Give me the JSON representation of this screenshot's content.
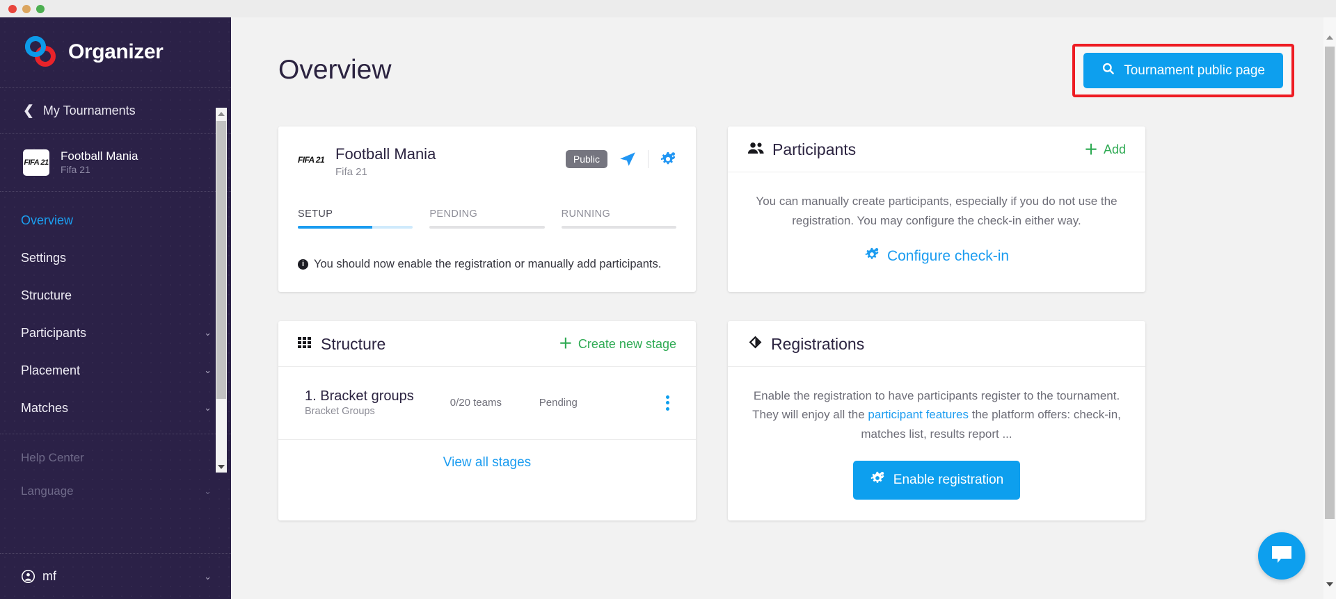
{
  "window": {
    "traffic_lights": [
      "close",
      "minimize",
      "maximize"
    ]
  },
  "sidebar": {
    "brand": "Organizer",
    "back_link": "My Tournaments",
    "tournament": {
      "thumb_label": "FIFA 21",
      "name": "Football Mania",
      "game": "Fifa 21"
    },
    "nav": [
      {
        "label": "Overview",
        "active": true,
        "expandable": false
      },
      {
        "label": "Settings",
        "active": false,
        "expandable": false
      },
      {
        "label": "Structure",
        "active": false,
        "expandable": false
      },
      {
        "label": "Participants",
        "active": false,
        "expandable": true
      },
      {
        "label": "Placement",
        "active": false,
        "expandable": true
      },
      {
        "label": "Matches",
        "active": false,
        "expandable": true
      }
    ],
    "secondary": [
      {
        "label": "Help Center",
        "expandable": false
      },
      {
        "label": "Language",
        "expandable": true
      }
    ],
    "user": {
      "label": "mf"
    }
  },
  "header": {
    "title": "Overview",
    "public_page_button": "Tournament public page"
  },
  "tournament_card": {
    "thumb_label": "FIFA 21",
    "name": "Football Mania",
    "game": "Fifa 21",
    "visibility_badge": "Public",
    "steps": [
      {
        "label": "SETUP",
        "active": true,
        "progress": 65
      },
      {
        "label": "PENDING",
        "active": false,
        "progress": 0
      },
      {
        "label": "RUNNING",
        "active": false,
        "progress": 0
      }
    ],
    "note": "You should now enable the registration or manually add participants."
  },
  "participants_card": {
    "title": "Participants",
    "add_label": "Add",
    "description": "You can manually create participants, especially if you do not use the registration. You may configure the check-in either way.",
    "configure_link": "Configure check-in"
  },
  "structure_card": {
    "title": "Structure",
    "create_label": "Create new stage",
    "stages": [
      {
        "name": "1. Bracket groups",
        "type": "Bracket Groups",
        "teams": "0/20 teams",
        "status": "Pending"
      }
    ],
    "view_all": "View all stages"
  },
  "registrations_card": {
    "title": "Registrations",
    "description_part1": "Enable the registration to have participants register to the tournament. They will enjoy all the ",
    "description_link": "participant features",
    "description_part2": " the platform offers: check-in, matches list, results report ...",
    "enable_button": "Enable registration"
  },
  "colors": {
    "sidebar_bg": "#2b2147",
    "accent_blue": "#0d9fee",
    "active_blue": "#1ba0f2",
    "green": "#2eaa53",
    "highlight_red": "#ee1c23",
    "badge_gray": "#75757f",
    "page_bg": "#f2f2f2"
  }
}
